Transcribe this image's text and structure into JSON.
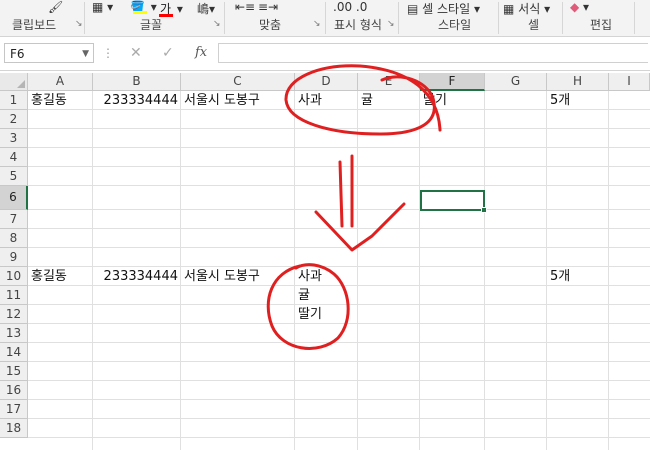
{
  "ribbon": {
    "groups": [
      "클립보드",
      "글꼴",
      "맞춤",
      "표시 형식",
      "스타일",
      "셀",
      "편집"
    ],
    "top_labels": {
      "cell_style": "셀 스타일",
      "format": "서식"
    }
  },
  "formula_bar": {
    "name_box": "F6",
    "formula": ""
  },
  "columns": [
    "A",
    "B",
    "C",
    "D",
    "E",
    "F",
    "G",
    "H",
    "I"
  ],
  "rows": [
    "1",
    "2",
    "3",
    "4",
    "5",
    "6",
    "7",
    "8",
    "9",
    "10",
    "11",
    "12",
    "13",
    "14",
    "15",
    "16",
    "17",
    "18"
  ],
  "active_cell": {
    "column": "F",
    "row": "6"
  },
  "cells": {
    "A1": "홍길동",
    "B1": "233334444",
    "C1": "서울시 도봉구",
    "D1": "사과",
    "E1": "귤",
    "F1": "딸기",
    "H1": "5개",
    "A10": "홍길동",
    "B10": "233334444",
    "C10": "서울시 도봉구",
    "D10_line1": "사과",
    "D10_line2": "귤",
    "D10_line3": "딸기",
    "H10": "5개"
  },
  "colors": {
    "accent": "#217346",
    "ink": "#e02020"
  }
}
